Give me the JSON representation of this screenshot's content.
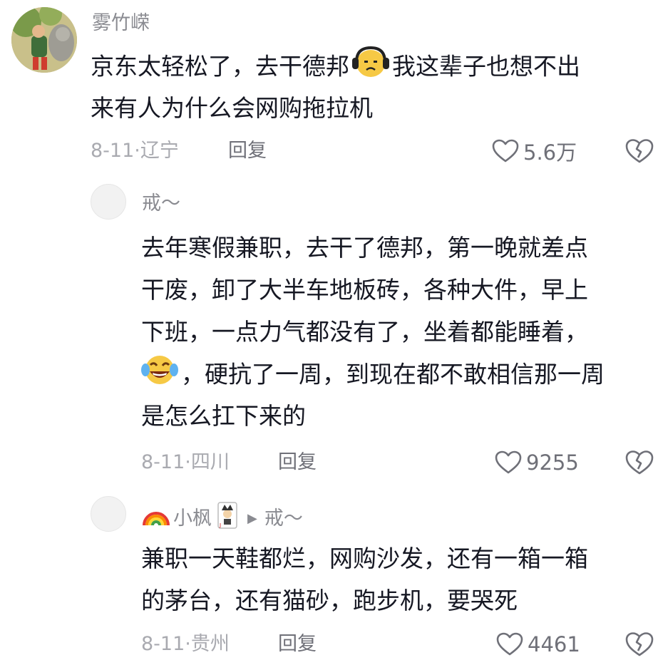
{
  "comments": [
    {
      "username": "雾竹嵘",
      "lines": [
        "京东太轻松了，去干德邦",
        "我这辈子也想不出",
        "来有人为什么会网购拖拉机"
      ],
      "date": "8-11·",
      "location": "辽宁",
      "reply_label": "回复",
      "likes": "5.6万"
    },
    {
      "username": "戒～",
      "lines": [
        "去年寒假兼职，去干了德邦，第一晚就差点",
        "干废，卸了大半车地板砖，各种大件，早上",
        "下班，一点力气都没有了，坐着都能睡着，",
        "，硬抗了一周，到现在都不敢相信那一周",
        "是怎么扛下来的"
      ],
      "date": "8-11·",
      "location": "四川",
      "reply_label": "回复",
      "likes": "9255"
    },
    {
      "username": "小枫",
      "reply_to": "戒～",
      "lines": [
        "兼职一天鞋都烂，网购沙发，还有一箱一箱",
        "的茅台，还有猫砂，跑步机，要哭死"
      ],
      "date": "8-11·",
      "location": "贵州",
      "reply_label": "回复",
      "likes": "4461"
    }
  ],
  "icons": {
    "like": "heart-outline-icon",
    "dislike": "broken-heart-icon"
  },
  "colors": {
    "text": "#161823",
    "secondary": "#8a8b91"
  }
}
